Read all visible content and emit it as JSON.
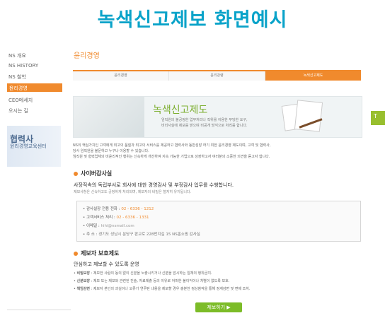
{
  "overlay": {
    "title": "녹색신고제보 화면예시"
  },
  "sidebar": {
    "items": [
      {
        "label": "NS 개요"
      },
      {
        "label": "NS HISTORY"
      },
      {
        "label": "NS 철학"
      },
      {
        "label": "윤리경영"
      },
      {
        "label": "CEO메세지"
      },
      {
        "label": "오시는 길"
      }
    ],
    "partner": {
      "title": "협력사",
      "subtitle": "윤리경영교육센터"
    }
  },
  "main": {
    "section_title": "윤리경영",
    "tabs": [
      {
        "label": "윤리경영"
      },
      {
        "label": "윤리강령"
      },
      {
        "label": "녹색신고제도"
      }
    ],
    "banner": {
      "headline": "녹색신고제도",
      "desc_line1": "임직원의 불공정한 업무처리나 직위를 이용한 부당한 요구,",
      "desc_line2": "비리사실에 제보를 받으며 비공개 방식으로 처리를 합니다."
    },
    "intro": {
      "line1": "NS의 핵심가치인 고객에게 최고의 품질과 최고의 서비스를 제공하고 협력사와 동반성장 하기 위한 윤리경영 제도이며, 고객 및 협력사,",
      "line2": "당사 임직원을 불문하고 누구나 이용할 수 있습니다.",
      "line3": "임직원 및 협력업체의 비윤리적인 행위는 신속하게 개선하여 지속 가능한 기업으로 성장하고자 여러분의 소중한 의견을 듣고자 합니다."
    },
    "audit": {
      "heading": "사이버감사실",
      "subheading": "사장직속의 독립부서로 회사에 대한 경영감사 및 부정감사 업무를 수행합니다.",
      "note": "제보사항은 신속하고도 공정하게 처리되며, 제보자의 비밀은 철저히 유지됩니다.",
      "contacts": [
        {
          "label": "감사실장 전용 전화 : ",
          "value": "02 - 6336 - 1212"
        },
        {
          "label": "고객서비스 처리 : ",
          "value": "02 - 6336 - 1331"
        },
        {
          "label": "이메일 : ",
          "value": "hihi@nsmall.com"
        },
        {
          "label": "주    소 : ",
          "value": "경기도 성남시 분당구 판교로 228번지길 15 NS홈쇼핑 감사실"
        }
      ]
    },
    "protect": {
      "heading": "제보자 보호제도",
      "subheading": "안심하고 제보할 수 있도록 운영",
      "items": [
        {
          "label": "비밀보장",
          "text": " : 제보한 사람의 동의 없이 신분을 노출시키거나 신분을 암시하는 일체의 행위금지."
        },
        {
          "label": "신분보장",
          "text": " : 제보 또는 제보와 관련된 진술, 자료제출 등의 이유로 어떠한 불이익이나 차별이 없도록 보호."
        },
        {
          "label": "책임감면",
          "text": " : 제보자 본인의 과실이나 오류가 연루된 내용을 제보할 경우 충분한 정상참작을 통해 징계감면 및 면제 조치."
        }
      ]
    },
    "report_button": "제보하기 ▶"
  },
  "side_tab": {
    "label": "T"
  },
  "colors": {
    "accent": "#f08a2d",
    "overlay_title": "#0aa3c9",
    "green": "#7cbc28"
  }
}
